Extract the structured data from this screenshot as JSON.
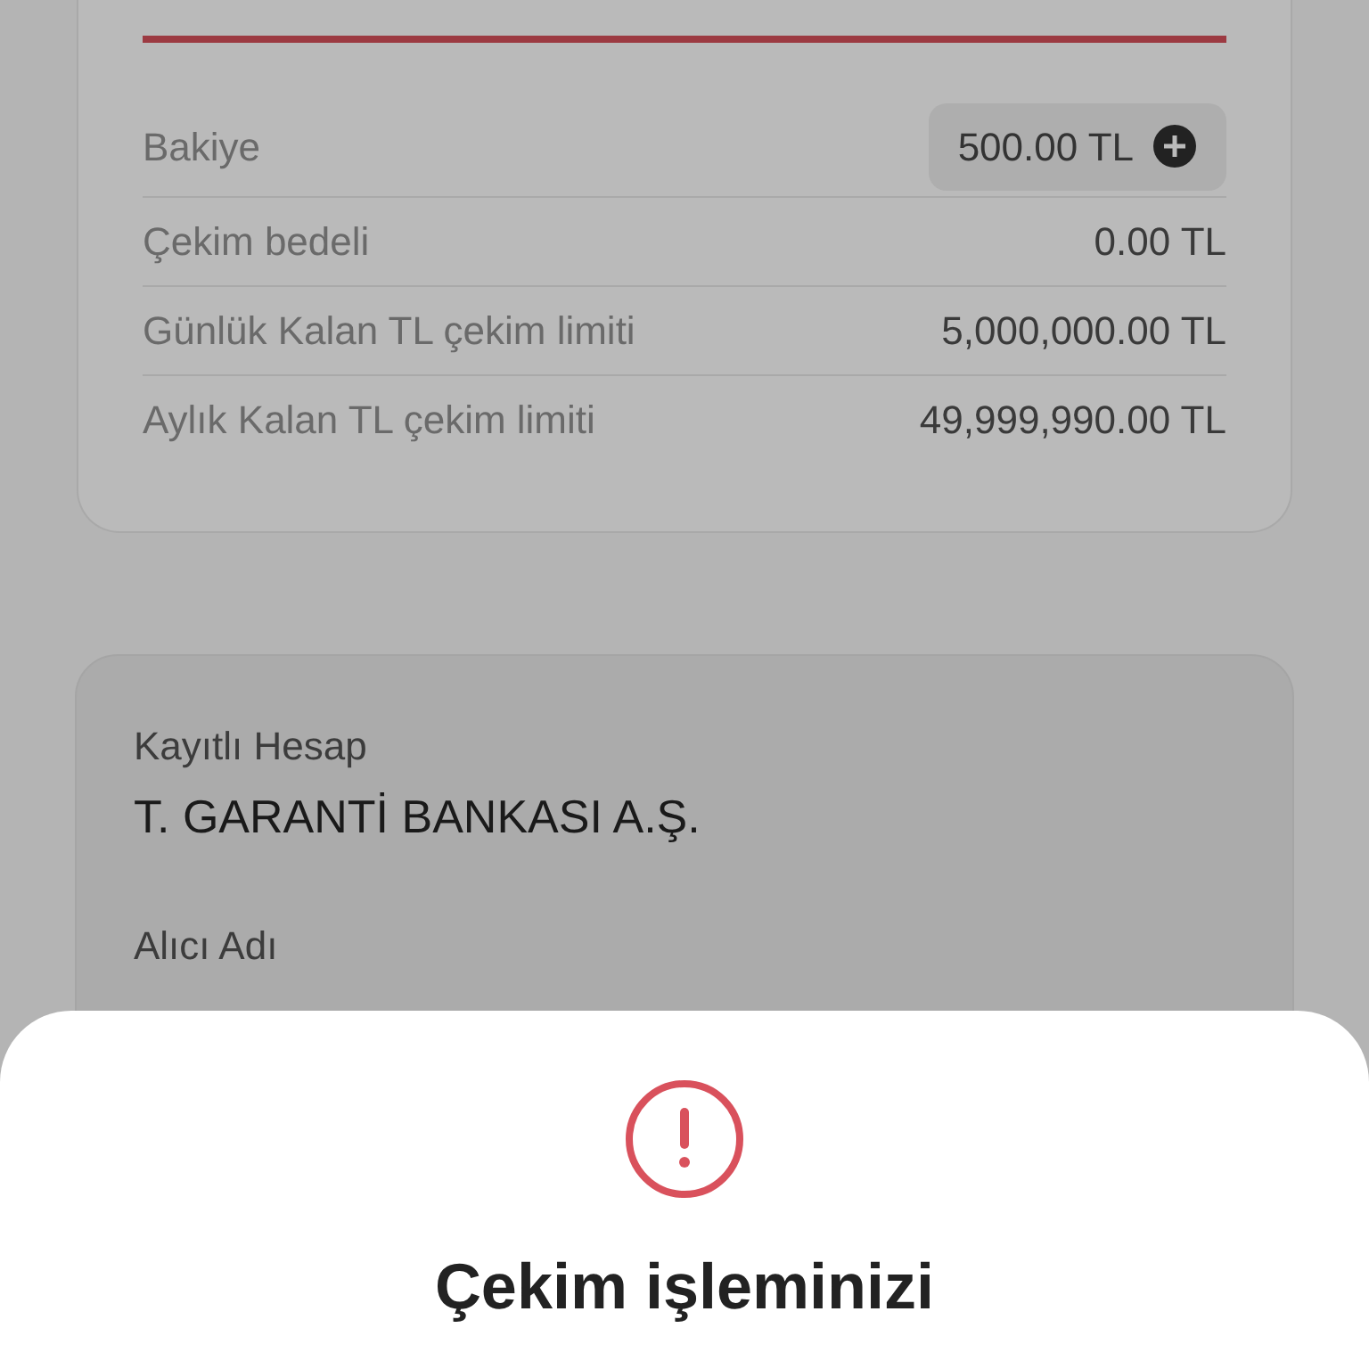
{
  "summary": {
    "rows": [
      {
        "label": "Bakiye",
        "value": "500.00 TL",
        "kind": "chip"
      },
      {
        "label": "Çekim bedeli",
        "value": "0.00 TL",
        "kind": "plain"
      },
      {
        "label": "Günlük Kalan TL çekim limiti",
        "value": "5,000,000.00 TL",
        "kind": "plain"
      },
      {
        "label": "Aylık Kalan TL çekim limiti",
        "value": "49,999,990.00 TL",
        "kind": "plain"
      }
    ]
  },
  "account": {
    "fields": [
      {
        "label": "Kayıtlı Hesap",
        "value": "T. GARANTİ BANKASI A.Ş."
      },
      {
        "label": "Alıcı Adı"
      }
    ]
  },
  "dialog": {
    "title": "Çekim işleminizi"
  }
}
